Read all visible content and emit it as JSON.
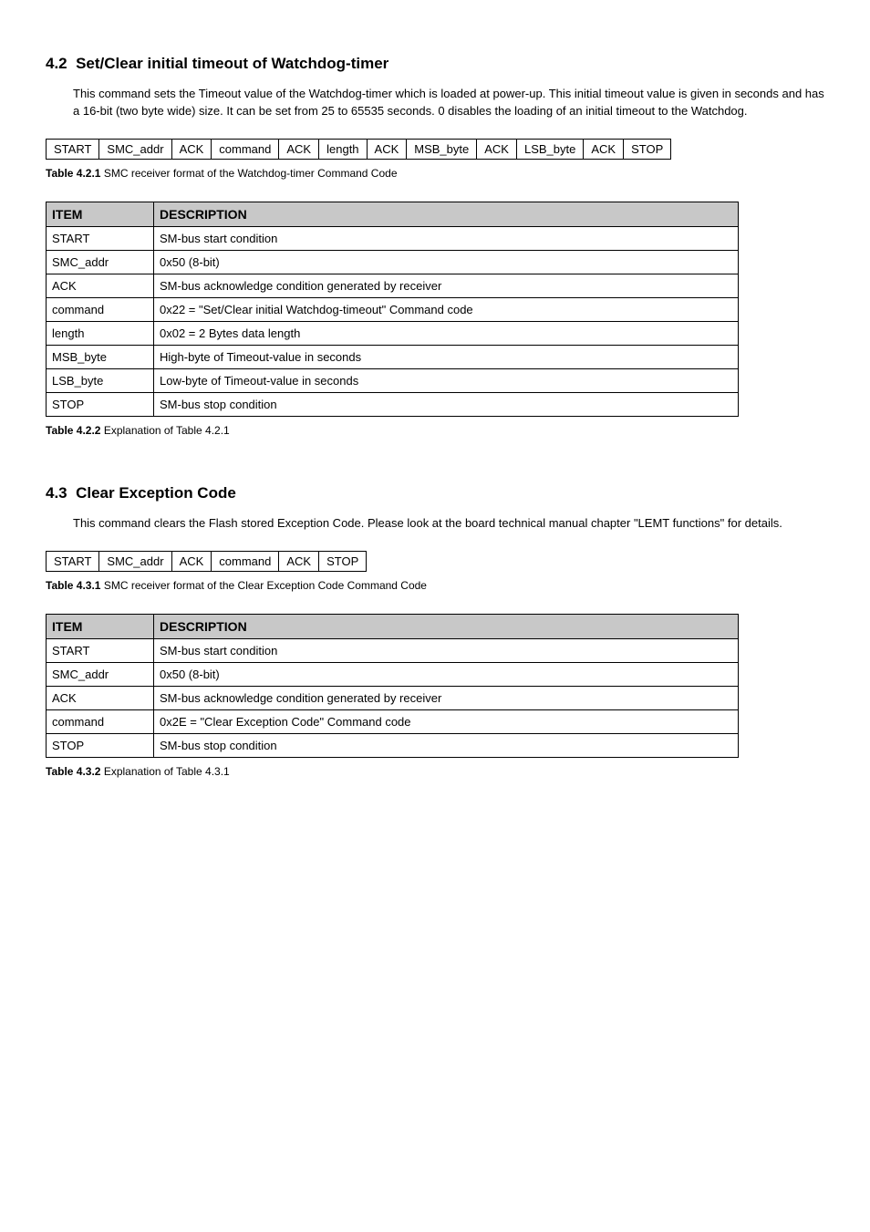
{
  "sec42": {
    "heading_num": "4.2",
    "heading_title": "Set/Clear initial timeout of Watchdog-timer",
    "body": "This command sets the Timeout value of the Watchdog-timer which is loaded at power-up. This initial timeout value is given in seconds and has a 16-bit (two byte wide) size. It can be set from 25 to 65535 seconds. 0 disables the loading of an initial timeout to the Watchdog.",
    "seq": [
      "START",
      "SMC_addr",
      "ACK",
      "command",
      "ACK",
      "length",
      "ACK",
      "MSB_byte",
      "ACK",
      "LSB_byte",
      "ACK",
      "STOP"
    ],
    "caption1_label": "Table 4.2.1",
    "caption1_text": "SMC receiver format of the Watchdog-timer Command Code",
    "desc_headers": [
      "ITEM",
      "DESCRIPTION"
    ],
    "desc_rows": [
      {
        "item": "START",
        "desc": "SM-bus start condition"
      },
      {
        "item": "SMC_addr",
        "desc": "0x50 (8-bit)"
      },
      {
        "item": "ACK",
        "desc": "SM-bus acknowledge condition generated by receiver"
      },
      {
        "item": "command",
        "desc": "0x22 = \"Set/Clear initial Watchdog-timeout\" Command code"
      },
      {
        "item": "length",
        "desc": "0x02 = 2 Bytes data length"
      },
      {
        "item": "MSB_byte",
        "desc": "High-byte of Timeout-value in seconds"
      },
      {
        "item": "LSB_byte",
        "desc": "Low-byte of Timeout-value in seconds"
      },
      {
        "item": "STOP",
        "desc": "SM-bus stop condition"
      }
    ],
    "caption2_label": "Table 4.2.2",
    "caption2_text": "Explanation of Table 4.2.1"
  },
  "sec43": {
    "heading_num": "4.3",
    "heading_title": "Clear Exception Code",
    "body": "This command clears the Flash stored Exception Code. Please look at the board technical manual chapter \"LEMT functions\" for details.",
    "seq": [
      "START",
      "SMC_addr",
      "ACK",
      "command",
      "ACK",
      "STOP"
    ],
    "caption1_label": "Table 4.3.1",
    "caption1_text": "SMC receiver format of the Clear Exception Code Command Code",
    "desc_headers": [
      "ITEM",
      "DESCRIPTION"
    ],
    "desc_rows": [
      {
        "item": "START",
        "desc": "SM-bus start condition"
      },
      {
        "item": "SMC_addr",
        "desc": "0x50 (8-bit)"
      },
      {
        "item": "ACK",
        "desc": "SM-bus acknowledge condition generated by receiver"
      },
      {
        "item": "command",
        "desc": "0x2E = \"Clear Exception Code\" Command code"
      },
      {
        "item": "STOP",
        "desc": "SM-bus stop condition"
      }
    ],
    "caption2_label": "Table 4.3.2",
    "caption2_text": "Explanation of Table 4.3.1"
  }
}
